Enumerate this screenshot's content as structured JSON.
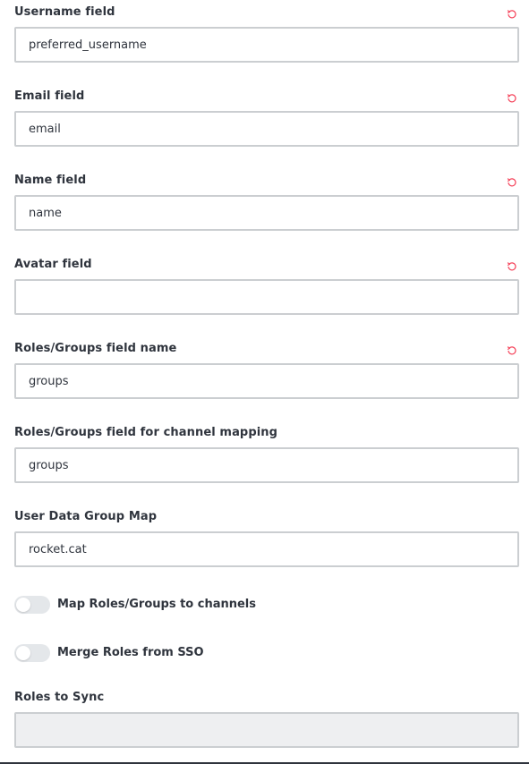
{
  "fields": [
    {
      "label": "Username field",
      "value": "preferred_username",
      "placeholder": "",
      "reset": true
    },
    {
      "label": "Email field",
      "value": "email",
      "placeholder": "",
      "reset": true
    },
    {
      "label": "Name field",
      "value": "name",
      "placeholder": "",
      "reset": true
    },
    {
      "label": "Avatar field",
      "value": "",
      "placeholder": "",
      "reset": true
    },
    {
      "label": "Roles/Groups field name",
      "value": "groups",
      "placeholder": "",
      "reset": true
    },
    {
      "label": "Roles/Groups field for channel mapping",
      "value": "groups",
      "placeholder": "",
      "reset": false
    },
    {
      "label": "User Data Group Map",
      "value": "rocket.cat",
      "placeholder": "",
      "reset": false
    }
  ],
  "toggles": [
    {
      "label": "Map Roles/Groups to channels",
      "checked": false
    },
    {
      "label": "Merge Roles from SSO",
      "checked": false
    }
  ],
  "roles_to_sync": {
    "label": "Roles to Sync",
    "value": "",
    "disabled": true
  },
  "colors": {
    "reset_icon": "#f5455c",
    "input_border": "#cbced1",
    "toggle_off": "#e4e7ea",
    "disabled_bg": "#eeeff1"
  },
  "icons": {
    "reset": "reset-icon"
  }
}
